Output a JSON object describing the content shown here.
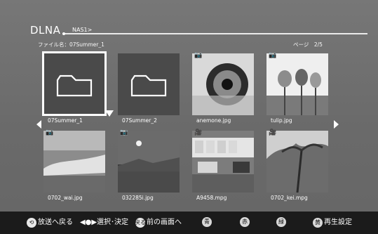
{
  "header": {
    "title": "DLNA",
    "breadcrumb": "NAS1>",
    "file_name_label": "ファイル名：07Summer_1",
    "page_indicator": "ページ　2/5"
  },
  "grid": {
    "items": [
      {
        "name": "07Summer_1",
        "type": "folder",
        "selected": true
      },
      {
        "name": "07Summer_2",
        "type": "folder",
        "selected": false
      },
      {
        "name": "anemone.jpg",
        "type": "photo",
        "icon": "camera-icon"
      },
      {
        "name": "tulip.jpg",
        "type": "photo",
        "icon": "camera-icon"
      },
      {
        "name": "0702_wai.jpg",
        "type": "photo",
        "icon": "camera-icon"
      },
      {
        "name": "032285i.jpg",
        "type": "photo",
        "icon": "camera-icon"
      },
      {
        "name": "A9458.mpg",
        "type": "video",
        "icon": "movie-camera-icon"
      },
      {
        "name": "0702_kei.mpg",
        "type": "video",
        "icon": "movie-camera-icon"
      }
    ]
  },
  "bottom_bar": {
    "items": [
      {
        "key": "back-to-broadcast",
        "icon": "broadcast-icon",
        "label": "放送へ戻る"
      },
      {
        "key": "select-enter",
        "icon": "dpad-icon",
        "label": "選択･決定"
      },
      {
        "key": "previous-screen",
        "icon": "back-icon",
        "label": "前の画面へ",
        "icon_label": "戻る"
      },
      {
        "key": "blue",
        "icon": "blue-button-icon",
        "label": "青",
        "icon_label": "青"
      },
      {
        "key": "red",
        "icon": "red-button-icon",
        "label": "赤",
        "icon_label": "赤"
      },
      {
        "key": "green",
        "icon": "green-button-icon",
        "label": "緑",
        "icon_label": "緑"
      },
      {
        "key": "yellow-playback",
        "icon": "yellow-button-icon",
        "label": "再生設定",
        "icon_label": "黄"
      }
    ]
  },
  "colors": {
    "background": "#6e6e6e",
    "bottom_bar": "#1b1b1b",
    "text": "#ffffff"
  }
}
